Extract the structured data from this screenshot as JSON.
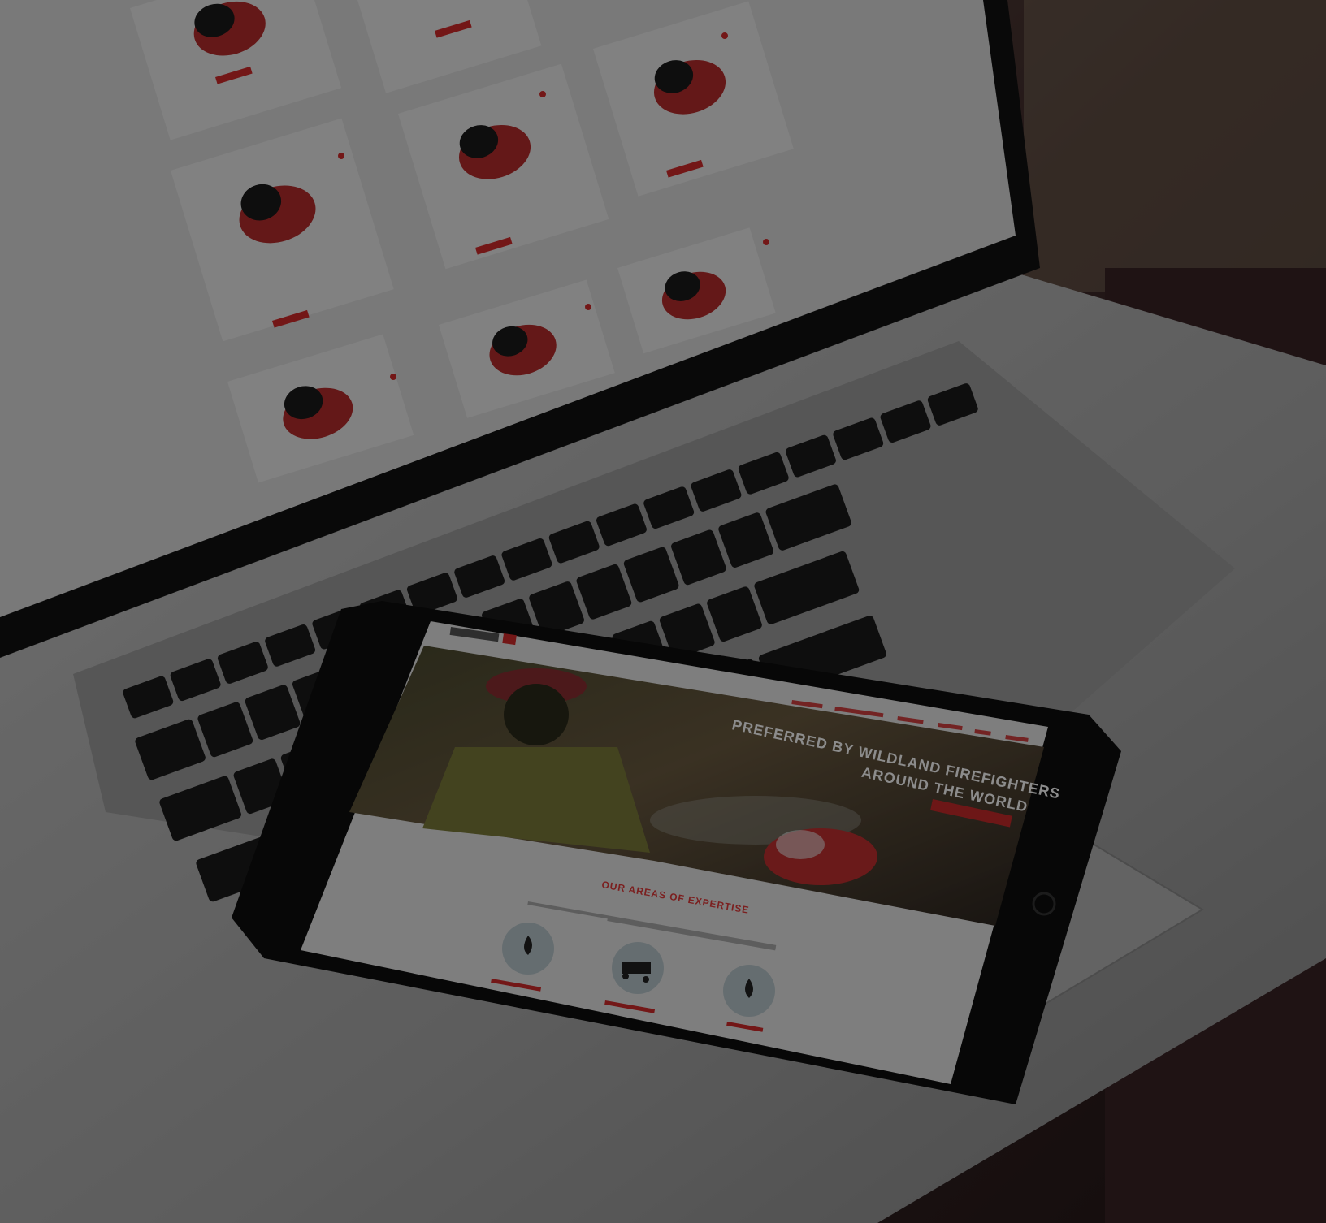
{
  "laptop": {
    "products": [
      {
        "name": "",
        "desc": ""
      },
      {
        "name": "",
        "desc": ""
      },
      {
        "name": "",
        "desc": ""
      },
      {
        "name": "",
        "desc": ""
      },
      {
        "name": "",
        "desc": ""
      },
      {
        "name": "",
        "desc": ""
      }
    ]
  },
  "tablet": {
    "hero_title_line1": "PREFERRED BY WILDLAND FIREFIGHTERS",
    "hero_title_line2": "AROUND THE WORLD",
    "areas_heading": "OUR AREAS OF EXPERTISE",
    "icons": [
      "flame-icon",
      "truck-icon",
      "drop-icon"
    ]
  },
  "colors": {
    "accent": "#d22a2a",
    "background": "#2a1f1f"
  }
}
